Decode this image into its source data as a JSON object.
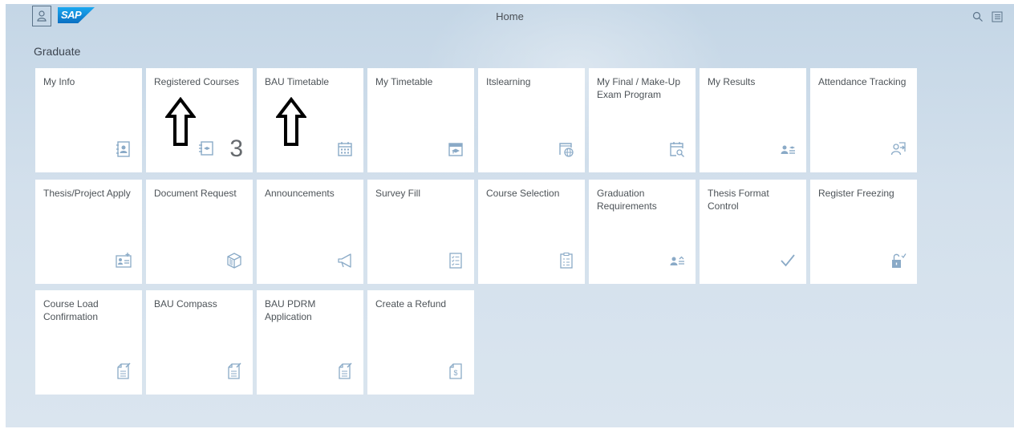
{
  "header": {
    "title": "Home",
    "logo_text": "SAP",
    "icons": [
      "user-icon",
      "search-icon",
      "menu-icon"
    ]
  },
  "group": {
    "title": "Graduate"
  },
  "tiles": [
    {
      "label": "My Info",
      "icon": "contact-card-icon"
    },
    {
      "label": "Registered Courses",
      "icon": "course-book-icon",
      "count": "3"
    },
    {
      "label": "BAU Timetable",
      "icon": "calendar-icon"
    },
    {
      "label": "My Timetable",
      "icon": "education-calendar-icon"
    },
    {
      "label": "Itslearning",
      "icon": "web-calendar-icon"
    },
    {
      "label": "My Final / Make-Up Exam Program",
      "icon": "calendar-search-icon"
    },
    {
      "label": "My Results",
      "icon": "employee-result-icon"
    },
    {
      "label": "Attendance Tracking",
      "icon": "user-transfer-icon"
    },
    {
      "label": "Thesis/Project Apply",
      "icon": "add-contact-card-icon"
    },
    {
      "label": "Document Request",
      "icon": "product-box-icon"
    },
    {
      "label": "Announcements",
      "icon": "megaphone-icon"
    },
    {
      "label": "Survey Fill",
      "icon": "checklist-icon"
    },
    {
      "label": "Course Selection",
      "icon": "clipboard-icon"
    },
    {
      "label": "Graduation Requirements",
      "icon": "employee-requirements-icon"
    },
    {
      "label": "Thesis Format Control",
      "icon": "checkmark-icon"
    },
    {
      "label": "Register Freezing",
      "icon": "unlock-check-icon"
    },
    {
      "label": "Course Load Confirmation",
      "icon": "edit-document-icon"
    },
    {
      "label": "BAU Compass",
      "icon": "edit-document-icon"
    },
    {
      "label": "BAU PDRM Application",
      "icon": "edit-document-icon"
    },
    {
      "label": "Create a Refund",
      "icon": "money-document-icon"
    }
  ],
  "colors": {
    "icon": "#8aaac7",
    "text": "#4d5358",
    "background": "#d3e0ec"
  }
}
